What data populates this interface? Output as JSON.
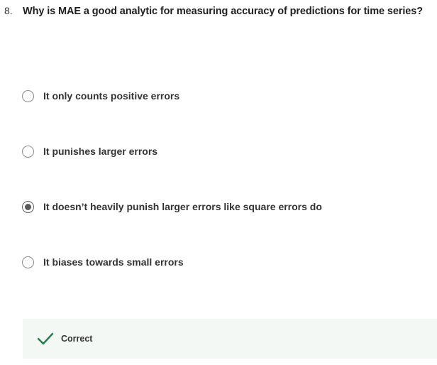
{
  "question": {
    "number": "8.",
    "text": "Why is MAE a good analytic for measuring accuracy of predictions for time series?"
  },
  "options": [
    {
      "label": "It only counts positive errors",
      "selected": false
    },
    {
      "label": "It punishes larger errors",
      "selected": false
    },
    {
      "label": "It doesn’t heavily punish larger errors like square errors do",
      "selected": true
    },
    {
      "label": "It biases towards small errors",
      "selected": false
    }
  ],
  "feedback": {
    "status": "Correct",
    "icon": "checkmark-icon",
    "color": "#1e7f4f",
    "background": "#f3f8f5"
  }
}
